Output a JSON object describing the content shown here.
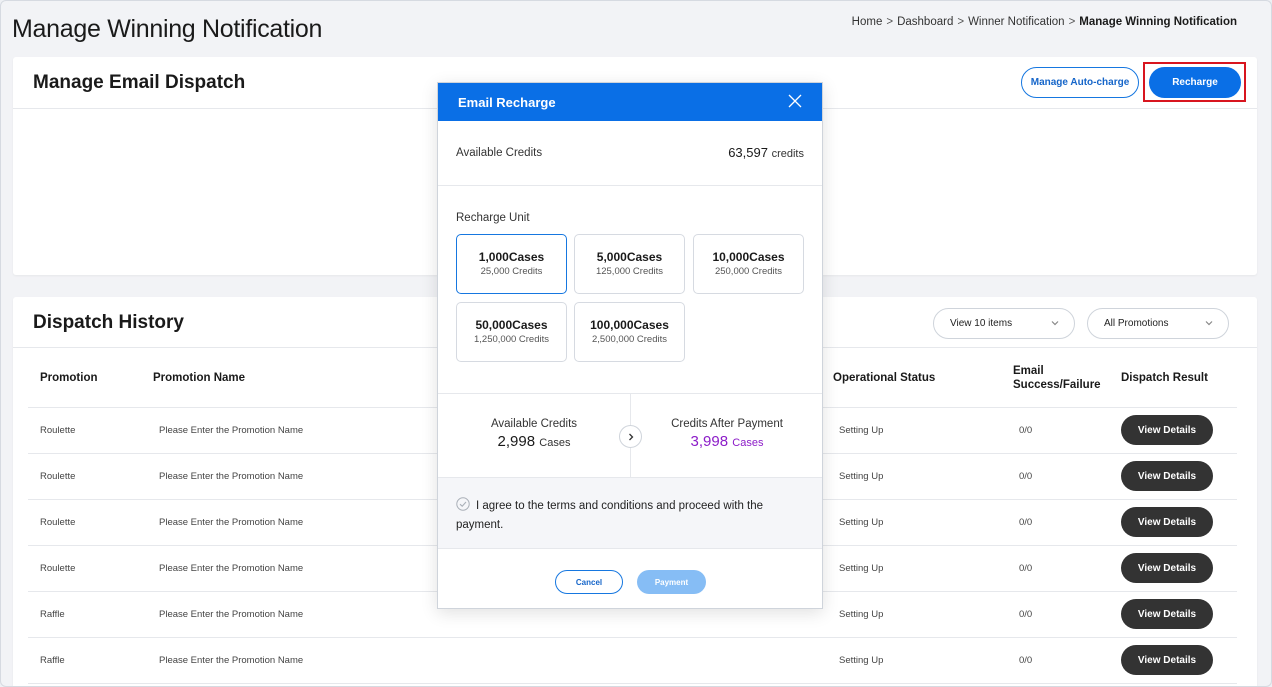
{
  "page": {
    "title": "Manage Winning Notification",
    "breadcrumb": [
      "Home",
      "Dashboard",
      "Winner Notification",
      "Manage Winning Notification"
    ],
    "breadcrumb_separator": ">"
  },
  "email_dispatch": {
    "title": "Manage Email Dispatch",
    "auto_charge_label": "Manage Auto-charge",
    "recharge_label": "Recharge"
  },
  "history": {
    "title": "Dispatch History",
    "view_select": "View 10 items",
    "promotion_select": "All Promotions",
    "columns": {
      "promotion": "Promotion",
      "promotion_name": "Promotion Name",
      "operational_status": "Operational Status",
      "email_line1": "Email",
      "email_line2": "Success/Failure",
      "dispatch_result": "Dispatch Result"
    },
    "rows": [
      {
        "promotion": "Roulette",
        "name": "Please Enter the Promotion Name",
        "status": "Setting Up",
        "email": "0/0",
        "action": "View Details"
      },
      {
        "promotion": "Roulette",
        "name": "Please Enter the Promotion Name",
        "status": "Setting Up",
        "email": "0/0",
        "action": "View Details"
      },
      {
        "promotion": "Roulette",
        "name": "Please Enter the Promotion Name",
        "status": "Setting Up",
        "email": "0/0",
        "action": "View Details"
      },
      {
        "promotion": "Roulette",
        "name": "Please Enter the Promotion Name",
        "status": "Setting Up",
        "email": "0/0",
        "action": "View Details"
      },
      {
        "promotion": "Raffle",
        "name": "Please Enter the Promotion Name",
        "status": "Setting Up",
        "email": "0/0",
        "action": "View Details"
      },
      {
        "promotion": "Raffle",
        "name": "Please Enter the Promotion Name",
        "status": "Setting Up",
        "email": "0/0",
        "action": "View Details"
      }
    ]
  },
  "modal": {
    "title": "Email Recharge",
    "available_credits_label": "Available Credits",
    "available_credits_value": "63,597",
    "available_credits_unit": "credits",
    "recharge_unit_label": "Recharge Unit",
    "units": [
      {
        "cases": "1,000Cases",
        "credits": "25,000 Credits",
        "selected": true
      },
      {
        "cases": "5,000Cases",
        "credits": "125,000 Credits",
        "selected": false
      },
      {
        "cases": "10,000Cases",
        "credits": "250,000 Credits",
        "selected": false
      },
      {
        "cases": "50,000Cases",
        "credits": "1,250,000 Credits",
        "selected": false
      },
      {
        "cases": "100,000Cases",
        "credits": "2,500,000 Credits",
        "selected": false
      }
    ],
    "summary": {
      "left_label": "Available Credits",
      "left_value": "2,998",
      "left_unit": "Cases",
      "right_label": "Credits After Payment",
      "right_value": "3,998",
      "right_unit": "Cases"
    },
    "agree_text": "I agree to the terms and conditions and proceed with the payment.",
    "cancel_label": "Cancel",
    "payment_label": "Payment"
  },
  "colors": {
    "primary": "#0a6fe6",
    "highlight": "#d8151f",
    "after_payment": "#8c1cc8",
    "dark_button": "#333333"
  }
}
